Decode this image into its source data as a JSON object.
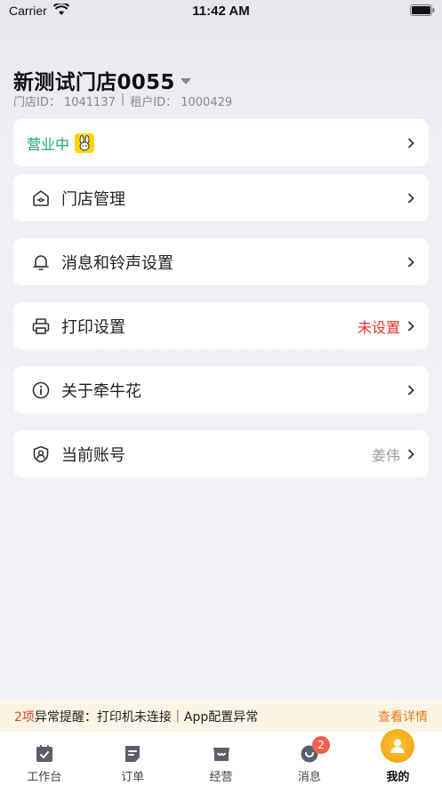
{
  "status_bar": {
    "carrier": "Carrier",
    "time": "11:42 AM"
  },
  "store": {
    "name": "新测试门店0055",
    "store_id_text": "门店ID： 1041137",
    "separator": "|",
    "tenant_id_text": "租户ID： 1000429"
  },
  "business_status": {
    "label": "营业中"
  },
  "menu": {
    "store_management": {
      "label": "门店管理"
    },
    "notification_settings": {
      "label": "消息和铃声设置"
    },
    "print_settings": {
      "label": "打印设置",
      "value": "未设置",
      "value_color": "#e8332a"
    },
    "about": {
      "label": "关于牵牛花"
    },
    "current_account": {
      "label": "当前账号",
      "value": "姜伟",
      "value_color": "#999999"
    }
  },
  "alert": {
    "count": "2项",
    "text": "异常提醒：打印机未连接｜App配置异常",
    "link": "查看详情"
  },
  "tabs": [
    {
      "label": "工作台",
      "icon": "calendar-check-icon"
    },
    {
      "label": "订单",
      "icon": "document-icon"
    },
    {
      "label": "经营",
      "icon": "storefront-icon"
    },
    {
      "label": "消息",
      "icon": "message-icon",
      "badge": "2"
    },
    {
      "label": "我的",
      "icon": "avatar-icon",
      "active": true
    }
  ],
  "colors": {
    "accent_green": "#1aa56b",
    "alert_red": "#e8432c",
    "link_orange": "#e87a18",
    "avatar_yellow": "#f7b21a"
  }
}
